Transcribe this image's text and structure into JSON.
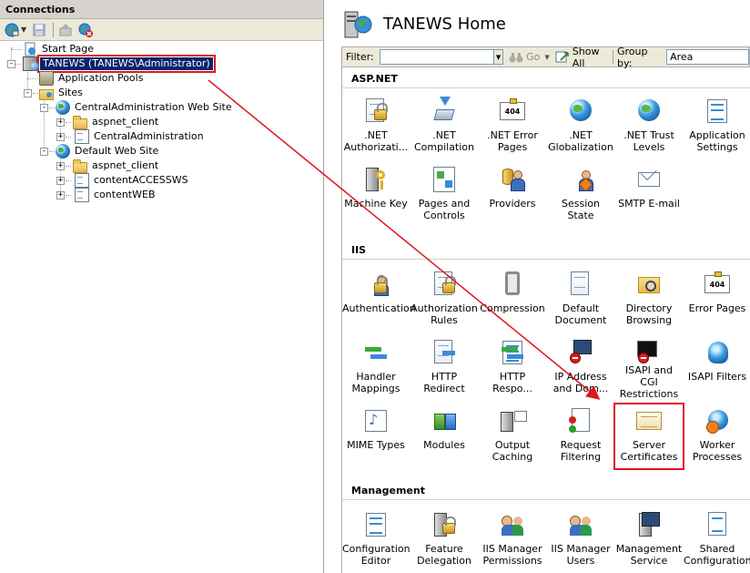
{
  "connections": {
    "title": "Connections",
    "tree": {
      "start_page": "Start Page",
      "server": "TANEWS (TANEWS\\Administrator)",
      "app_pools": "Application Pools",
      "sites": "Sites",
      "central_admin_site": "CentralAdministration Web Site",
      "aspnet_client_1": "aspnet_client",
      "central_admin": "CentralAdministration",
      "default_site": "Default Web Site",
      "aspnet_client_2": "aspnet_client",
      "content_access": "contentACCESSWS",
      "content_web": "contentWEB"
    }
  },
  "home": {
    "title": "TANEWS Home"
  },
  "filterbar": {
    "filter_label": "Filter:",
    "go_label": "Go",
    "show_all_label": "Show All",
    "group_by_label": "Group by:",
    "group_by_value": "Area"
  },
  "sections": {
    "aspnet": "ASP.NET",
    "iis": "IIS",
    "management": "Management"
  },
  "features": {
    "aspnet": [
      {
        "line1": ".NET",
        "line2": "Authorizati..."
      },
      {
        "line1": ".NET",
        "line2": "Compilation"
      },
      {
        "line1": ".NET Error",
        "line2": "Pages"
      },
      {
        "line1": ".NET",
        "line2": "Globalization"
      },
      {
        "line1": ".NET Trust",
        "line2": "Levels"
      },
      {
        "line1": "Application",
        "line2": "Settings"
      },
      {
        "line1": "Machine Key",
        "line2": ""
      },
      {
        "line1": "Pages and",
        "line2": "Controls"
      },
      {
        "line1": "Providers",
        "line2": ""
      },
      {
        "line1": "Session State",
        "line2": ""
      },
      {
        "line1": "SMTP E-mail",
        "line2": ""
      }
    ],
    "iis": [
      {
        "line1": "Authentication",
        "line2": ""
      },
      {
        "line1": "Authorization",
        "line2": "Rules"
      },
      {
        "line1": "Compression",
        "line2": ""
      },
      {
        "line1": "Default",
        "line2": "Document"
      },
      {
        "line1": "Directory",
        "line2": "Browsing"
      },
      {
        "line1": "Error Pages",
        "line2": ""
      },
      {
        "line1": "Handler",
        "line2": "Mappings"
      },
      {
        "line1": "HTTP Redirect",
        "line2": ""
      },
      {
        "line1": "HTTP",
        "line2": "Respo..."
      },
      {
        "line1": "IP Address",
        "line2": "and Dom..."
      },
      {
        "line1": "ISAPI and CGI",
        "line2": "Restrictions"
      },
      {
        "line1": "ISAPI Filters",
        "line2": ""
      },
      {
        "line1": "MIME Types",
        "line2": ""
      },
      {
        "line1": "Modules",
        "line2": ""
      },
      {
        "line1": "Output",
        "line2": "Caching"
      },
      {
        "line1": "Request",
        "line2": "Filtering"
      },
      {
        "line1": "Server",
        "line2": "Certificates"
      },
      {
        "line1": "Worker",
        "line2": "Processes"
      }
    ],
    "management": [
      {
        "line1": "Configuration",
        "line2": "Editor"
      },
      {
        "line1": "Feature",
        "line2": "Delegation"
      },
      {
        "line1": "IIS Manager",
        "line2": "Permissions"
      },
      {
        "line1": "IIS Manager",
        "line2": "Users"
      },
      {
        "line1": "Management",
        "line2": "Service"
      },
      {
        "line1": "Shared",
        "line2": "Configuration"
      }
    ]
  },
  "icons": {
    "toolbar": [
      "connect-icon",
      "save-icon",
      "up-icon",
      "disconnect-icon"
    ],
    "aspnet": [
      "net-authorization-icon",
      "net-compilation-icon",
      "net-error-pages-icon",
      "net-globalization-icon",
      "net-trust-levels-icon",
      "application-settings-icon",
      "machine-key-icon",
      "pages-controls-icon",
      "providers-icon",
      "session-state-icon",
      "smtp-email-icon"
    ],
    "iis": [
      "authentication-icon",
      "authorization-rules-icon",
      "compression-icon",
      "default-document-icon",
      "directory-browsing-icon",
      "error-pages-icon",
      "handler-mappings-icon",
      "http-redirect-icon",
      "http-response-headers-icon",
      "ip-domain-restrictions-icon",
      "isapi-cgi-icon",
      "isapi-filters-icon",
      "mime-types-icon",
      "modules-icon",
      "output-caching-icon",
      "request-filtering-icon",
      "server-certificates-icon",
      "worker-processes-icon"
    ],
    "management": [
      "configuration-editor-icon",
      "feature-delegation-icon",
      "iis-manager-permissions-icon",
      "iis-manager-users-icon",
      "management-service-icon",
      "shared-configuration-icon"
    ]
  },
  "colors": {
    "selection": "#0a246a",
    "annotation_red": "#e0141e",
    "pane_header": "#d6d3ce",
    "toolbar": "#ece9d8"
  }
}
